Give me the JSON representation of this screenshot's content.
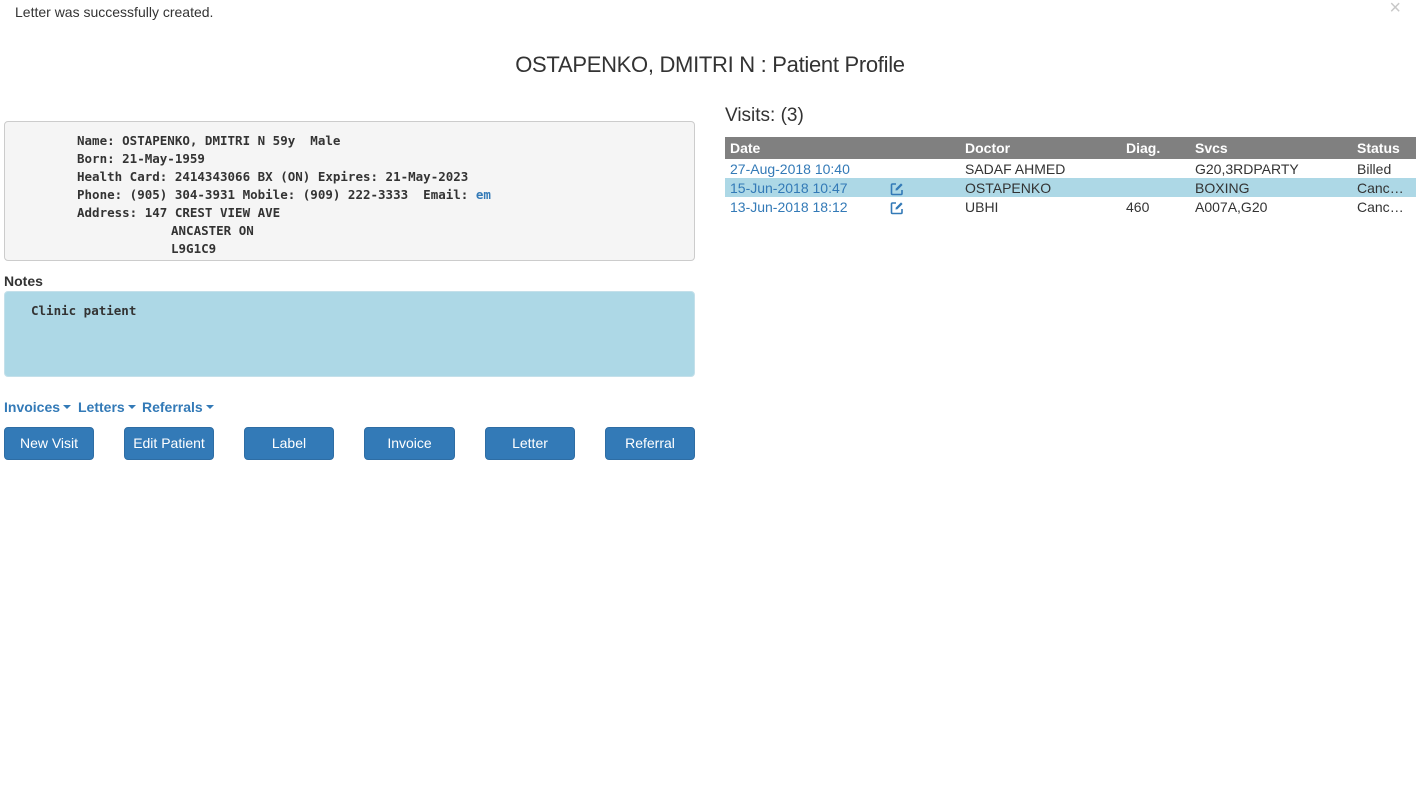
{
  "alert": {
    "message": "Letter was successfully created.",
    "close": "×"
  },
  "page_title": "OSTAPENKO, DMITRI N : Patient Profile",
  "demographics": {
    "name_line": "Name: OSTAPENKO, DMITRI N 59y  Male",
    "born_line": "Born: 21-May-1959",
    "health_card_line": "Health Card: 2414343066 BX (ON) Expires: 21-May-2023",
    "phone_line_prefix": "Phone: (905) 304-3931 Mobile: (909) 222-3333  Email: ",
    "email_link": "em",
    "address_line": "Address: 147 CREST VIEW AVE",
    "city_line": "ANCASTER ON",
    "postal_line": "L9G1C9"
  },
  "notes": {
    "label": "Notes",
    "text": "Clinic patient"
  },
  "menus": {
    "invoices": "Invoices",
    "letters": "Letters",
    "referrals": "Referrals"
  },
  "buttons": {
    "new_visit": "New Visit",
    "edit_patient": "Edit Patient",
    "label": "Label",
    "invoice": "Invoice",
    "letter": "Letter",
    "referral": "Referral"
  },
  "visits": {
    "heading": "Visits: (3)",
    "columns": {
      "date": "Date",
      "doctor": "Doctor",
      "diag": "Diag.",
      "svcs": "Svcs",
      "status": "Status"
    },
    "rows": [
      {
        "date": "27-Aug-2018 10:40",
        "editable": false,
        "doctor": "SADAF AHMED",
        "diag": "",
        "svcs": "G20,3RDPARTY",
        "status": "Billed",
        "selected": false
      },
      {
        "date": "15-Jun-2018 10:47",
        "editable": true,
        "doctor": "OSTAPENKO",
        "diag": "",
        "svcs": "BOXING",
        "status": "Cancelled",
        "selected": true
      },
      {
        "date": "13-Jun-2018 18:12",
        "editable": true,
        "doctor": "UBHI",
        "diag": "460",
        "svcs": "A007A,G20",
        "status": "Cancelled",
        "selected": false
      }
    ]
  },
  "colors": {
    "link": "#337ab7",
    "button": "#337ab7",
    "notes_bg": "#add8e6",
    "table_header": "#808080"
  }
}
